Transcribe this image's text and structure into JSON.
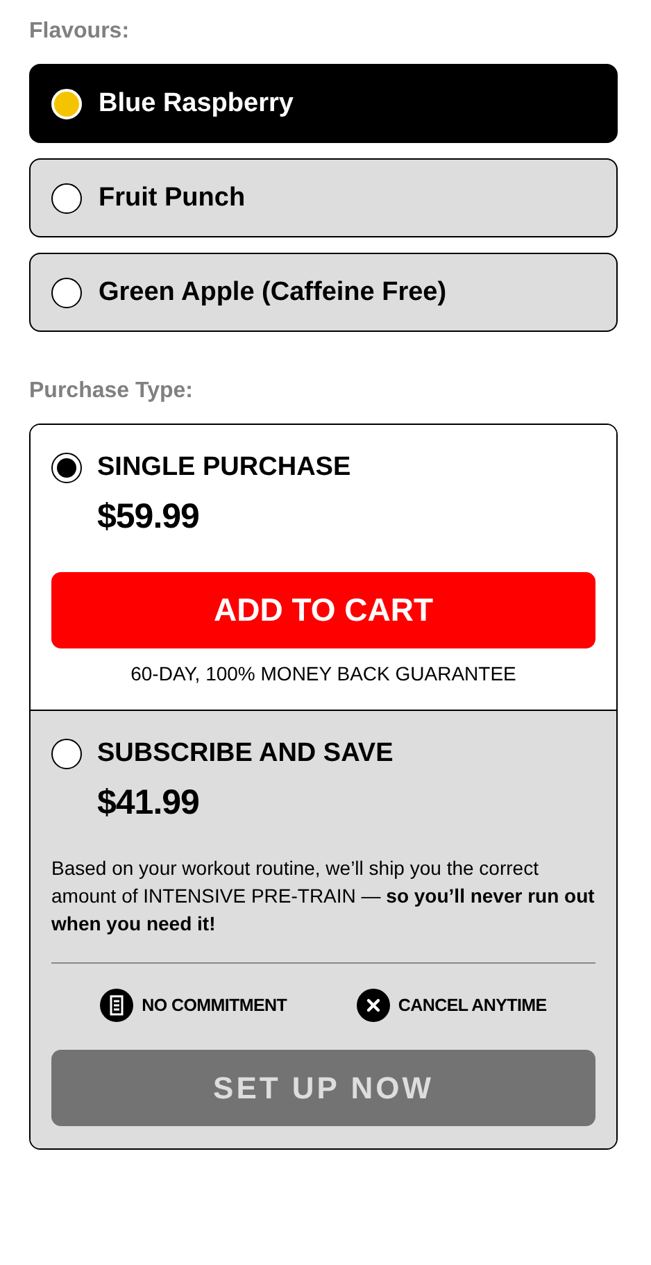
{
  "flavours": {
    "label": "Flavours:",
    "options": [
      {
        "label": "Blue Raspberry",
        "selected": true
      },
      {
        "label": "Fruit Punch",
        "selected": false
      },
      {
        "label": "Green Apple (Caffeine Free)",
        "selected": false
      }
    ]
  },
  "purchase_type": {
    "label": "Purchase Type:",
    "options": [
      {
        "kind": "single",
        "label": "SINGLE PURCHASE",
        "selected": true,
        "price": "$59.99",
        "button": {
          "label": "ADD TO CART",
          "disabled": false
        },
        "note": "60-DAY, 100% MONEY BACK GUARANTEE"
      },
      {
        "kind": "subscribe",
        "label": "SUBSCRIBE AND SAVE",
        "selected": false,
        "price": "$41.99",
        "description": "Based on your workout routine, we’ll ship you the correct amount of INTENSIVE PRE-TRAIN — **so you’ll never run out when you need it!**",
        "perks": [
          {
            "kind": "commitment",
            "label": "NO COMMITMENT"
          },
          {
            "kind": "cancel",
            "label": "CANCEL ANYTIME"
          }
        ],
        "button": {
          "label": "SET UP NOW",
          "disabled": true
        }
      }
    ]
  }
}
